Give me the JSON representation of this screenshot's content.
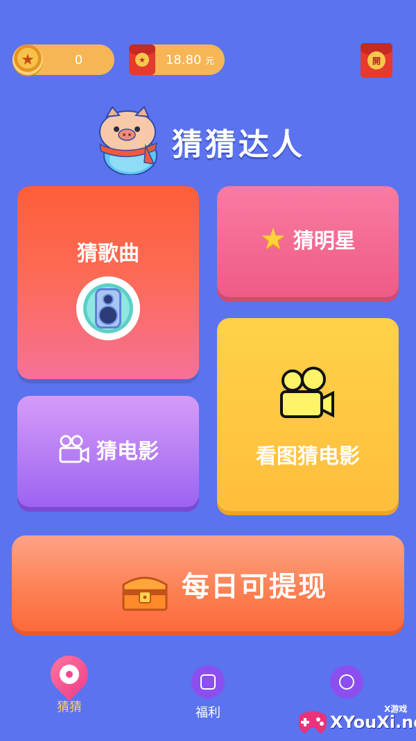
{
  "header": {
    "coins": "0",
    "cash_amount": "18.80",
    "cash_unit": "元",
    "envelope_open_label": "開"
  },
  "app": {
    "title": "猜猜达人"
  },
  "cards": {
    "song": "猜歌曲",
    "star": "猜明星",
    "movie": "猜电影",
    "picture_movie": "看图猜电影"
  },
  "withdraw": {
    "label": "每日可提现"
  },
  "nav": {
    "items": [
      {
        "label": "猜猜",
        "active": true
      },
      {
        "label": "福利",
        "active": false
      },
      {
        "label": "",
        "active": false
      }
    ]
  },
  "watermark": {
    "small": "X游戏",
    "text": "XYouXi.net"
  },
  "colors": {
    "background": "#5b73ee",
    "song_card": "#fe5e3a",
    "star_card": "#fa7ba2",
    "movie_card": "#9c63f1",
    "picture_card": "#ffc43f",
    "withdraw": "#fd7f51",
    "nav_active": "#f8d65a"
  }
}
